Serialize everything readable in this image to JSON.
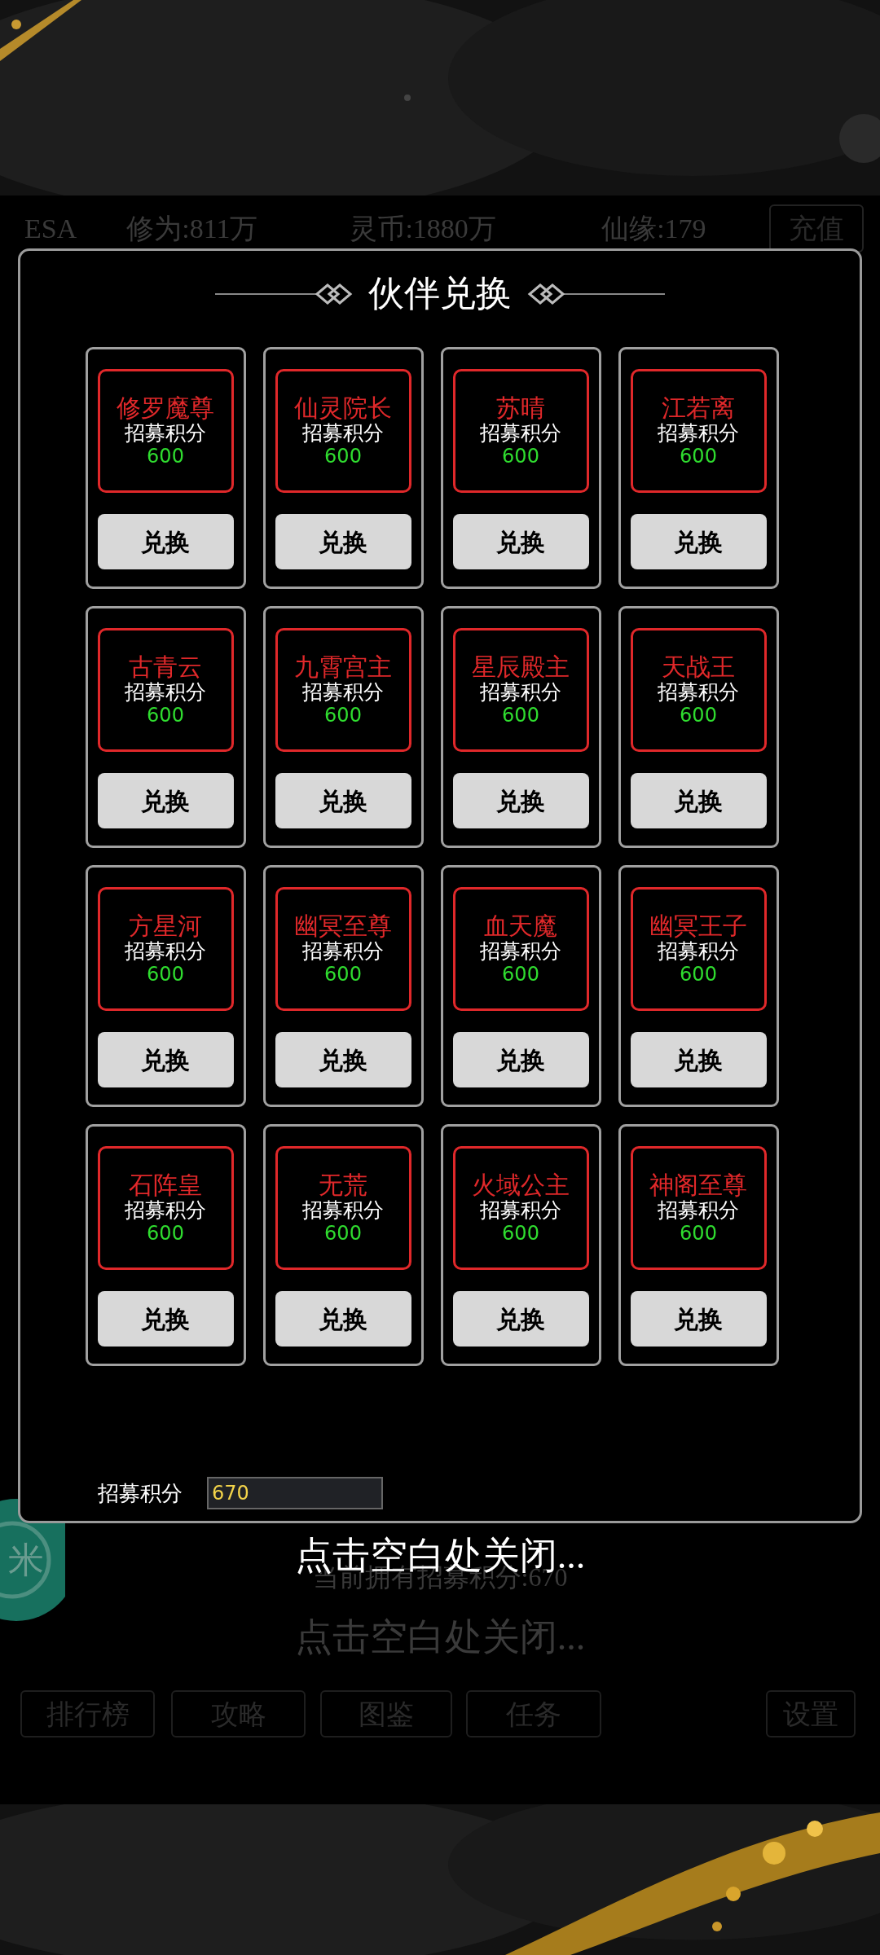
{
  "background_screen": {
    "top_bar": {
      "player": "ESA",
      "stats": [
        "修为:811万",
        "灵币:1880万",
        "仙缘:179"
      ],
      "recharge_button": "充值"
    },
    "points_line": "当前拥有招募积分:670",
    "close_hint": "点击空白处关闭...",
    "float_button": {
      "label": "米"
    },
    "bottom_buttons": [
      "排行榜",
      "攻略",
      "图鉴",
      "任务",
      "设置"
    ]
  },
  "dialog": {
    "title": "伙伴兑换",
    "items": [
      {
        "name": "修罗魔尊",
        "cost_label": "招募积分",
        "cost": "600",
        "button": "兑换"
      },
      {
        "name": "仙灵院长",
        "cost_label": "招募积分",
        "cost": "600",
        "button": "兑换"
      },
      {
        "name": "苏晴",
        "cost_label": "招募积分",
        "cost": "600",
        "button": "兑换"
      },
      {
        "name": "江若离",
        "cost_label": "招募积分",
        "cost": "600",
        "button": "兑换"
      },
      {
        "name": "古青云",
        "cost_label": "招募积分",
        "cost": "600",
        "button": "兑换"
      },
      {
        "name": "九霄宫主",
        "cost_label": "招募积分",
        "cost": "600",
        "button": "兑换"
      },
      {
        "name": "星辰殿主",
        "cost_label": "招募积分",
        "cost": "600",
        "button": "兑换"
      },
      {
        "name": "天战王",
        "cost_label": "招募积分",
        "cost": "600",
        "button": "兑换"
      },
      {
        "name": "方星河",
        "cost_label": "招募积分",
        "cost": "600",
        "button": "兑换"
      },
      {
        "name": "幽冥至尊",
        "cost_label": "招募积分",
        "cost": "600",
        "button": "兑换"
      },
      {
        "name": "血天魔",
        "cost_label": "招募积分",
        "cost": "600",
        "button": "兑换"
      },
      {
        "name": "幽冥王子",
        "cost_label": "招募积分",
        "cost": "600",
        "button": "兑换"
      },
      {
        "name": "石阵皇",
        "cost_label": "招募积分",
        "cost": "600",
        "button": "兑换"
      },
      {
        "name": "无荒",
        "cost_label": "招募积分",
        "cost": "600",
        "button": "兑换"
      },
      {
        "name": "火域公主",
        "cost_label": "招募积分",
        "cost": "600",
        "button": "兑换"
      },
      {
        "name": "神阁至尊",
        "cost_label": "招募积分",
        "cost": "600",
        "button": "兑换"
      }
    ],
    "points_label": "招募积分",
    "points_value": "670"
  },
  "close_hint": "点击空白处关闭..."
}
